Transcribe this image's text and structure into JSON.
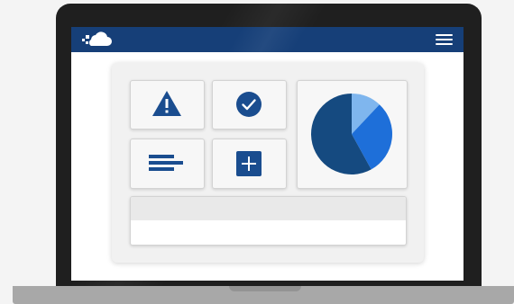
{
  "colors": {
    "header": "#163f78",
    "icon": "#1a4d8f",
    "pie_dark": "#154a80",
    "pie_mid": "#1e6fd9",
    "pie_light": "#7fb6ee"
  },
  "header": {
    "logo_icon": "cloud-icon",
    "menu_icon": "hamburger-menu-icon"
  },
  "tiles": [
    {
      "icon": "warning-icon"
    },
    {
      "icon": "check-circle-icon"
    },
    {
      "icon": "text-lines-icon"
    },
    {
      "icon": "plus-square-icon"
    }
  ],
  "pie_slices": [
    {
      "color": "pie_dark",
      "fraction": 0.58
    },
    {
      "color": "pie_mid",
      "fraction": 0.3
    },
    {
      "color": "pie_light",
      "fraction": 0.12
    }
  ]
}
